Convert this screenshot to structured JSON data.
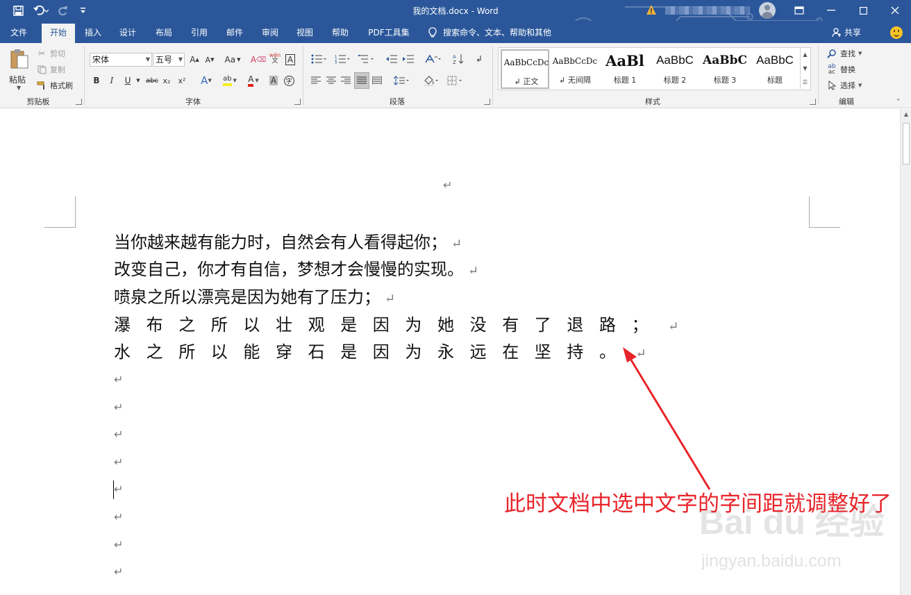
{
  "titlebar": {
    "doc_title": "我的文档.docx  -  Word",
    "qa_save": "save-icon",
    "qa_undo": "undo-icon",
    "qa_redo": "redo-icon",
    "qa_customize": "customize-icon",
    "warning": "warning-icon",
    "user": "avatar",
    "window_controls": [
      "ribbon-options-icon",
      "minimize-icon",
      "maximize-icon",
      "close-icon"
    ]
  },
  "tabs": [
    {
      "label": "文件"
    },
    {
      "label": "开始",
      "active": true
    },
    {
      "label": "插入"
    },
    {
      "label": "设计"
    },
    {
      "label": "布局"
    },
    {
      "label": "引用"
    },
    {
      "label": "邮件"
    },
    {
      "label": "审阅"
    },
    {
      "label": "视图"
    },
    {
      "label": "帮助"
    },
    {
      "label": "PDF工具集"
    }
  ],
  "tellme": {
    "text": "搜索命令、文本、帮助和其他"
  },
  "share": {
    "label": "共享"
  },
  "ribbon": {
    "clipboard": {
      "paste": "粘贴",
      "cut": "剪切",
      "copy": "复制",
      "format_painter": "格式刷",
      "label": "剪贴板"
    },
    "font": {
      "name": "宋体",
      "size": "五号",
      "label": "字体",
      "bold": "B",
      "italic": "I",
      "underline": "U",
      "strike": "abc",
      "subscript": "x₂",
      "superscript": "x²",
      "change_case": "Aa"
    },
    "paragraph": {
      "label": "段落"
    },
    "styles": {
      "label": "样式",
      "items": [
        {
          "preview": "AaBbCcDc",
          "name": "↲ 正文"
        },
        {
          "preview": "AaBbCcDc",
          "name": "↲ 无间隔"
        },
        {
          "preview": "AaBl",
          "name": "标题 1"
        },
        {
          "preview": "AaBbC",
          "name": "标题 2"
        },
        {
          "preview": "AaBbC",
          "name": "标题 3"
        },
        {
          "preview": "AaBbC",
          "name": "标题"
        }
      ]
    },
    "editing": {
      "label": "编辑",
      "find": "查找",
      "replace": "替换",
      "select": "选择"
    }
  },
  "document": {
    "lines": [
      "当你越来越有能力时，自然会有人看得起你；",
      "改变自己，你才有自信，梦想才会慢慢的实现。",
      "喷泉之所以漂亮是因为她有了压力；",
      "瀑布之所以壮观是因为她没有了退路；",
      "水之所以能穿石是因为永远在坚持。"
    ],
    "paragraph_mark": "↵"
  },
  "annotation": {
    "text": "此时文档中选中文字的字间距就调整好了",
    "color": "#e8242a"
  },
  "watermark": {
    "brand": "Bai du 经验",
    "url": "jingyan.baidu.com"
  },
  "colors": {
    "title_bar": "#2b579a",
    "ribbon": "#f3f3f3",
    "accent": "#2b579a"
  }
}
